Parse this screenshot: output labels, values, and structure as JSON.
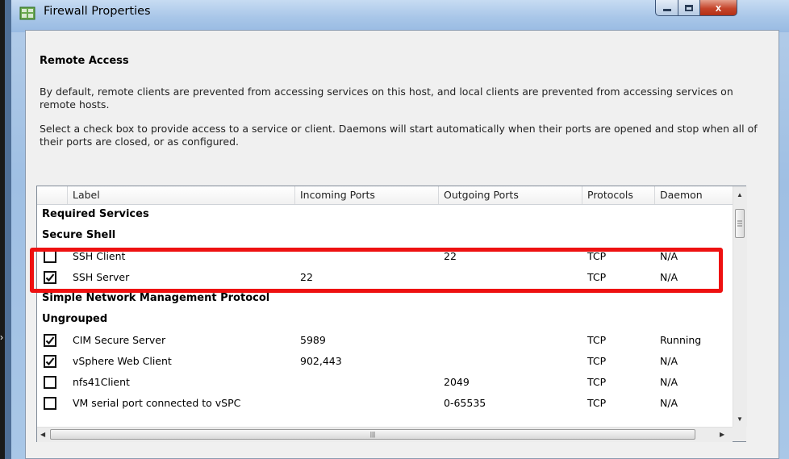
{
  "window": {
    "title": "Firewall Properties",
    "close_glyph": "x"
  },
  "section": {
    "title": "Remote Access",
    "paragraph1": "By default, remote clients are prevented from accessing services on this host, and local clients are prevented from accessing services on remote hosts.",
    "paragraph2": "Select a check box to provide access to a service or client. Daemons will start automatically when their ports are opened and stop when all of their ports are closed, or as configured."
  },
  "table": {
    "columns": [
      "Label",
      "Incoming Ports",
      "Outgoing Ports",
      "Protocols",
      "Daemon"
    ],
    "groups": {
      "required": "Required Services",
      "ssh": "Secure Shell",
      "snmp": "Simple Network Management Protocol",
      "ungrouped": "Ungrouped"
    },
    "rows": [
      {
        "label": "SSH Client",
        "incoming": "",
        "outgoing": "22",
        "protocol": "TCP",
        "daemon": "N/A",
        "checked": false
      },
      {
        "label": "SSH Server",
        "incoming": "22",
        "outgoing": "",
        "protocol": "TCP",
        "daemon": "N/A",
        "checked": true
      },
      {
        "label": "CIM Secure Server",
        "incoming": "5989",
        "outgoing": "",
        "protocol": "TCP",
        "daemon": "Running",
        "checked": true
      },
      {
        "label": "vSphere Web Client",
        "incoming": "902,443",
        "outgoing": "",
        "protocol": "TCP",
        "daemon": "N/A",
        "checked": true
      },
      {
        "label": "nfs41Client",
        "incoming": "",
        "outgoing": "2049",
        "protocol": "TCP",
        "daemon": "N/A",
        "checked": false
      },
      {
        "label": "VM serial port connected to vSPC",
        "incoming": "",
        "outgoing": "0-65535",
        "protocol": "TCP",
        "daemon": "N/A",
        "checked": false
      }
    ]
  },
  "colors": {
    "highlight": "#ee1111",
    "title_bar": "#a8c6e8",
    "close_button": "#c5452b"
  },
  "icons": [
    "firewall-app-icon",
    "minimize-icon",
    "maximize-icon",
    "close-icon",
    "checkbox-icon",
    "scroll-up-arrow-icon",
    "scroll-down-arrow-icon",
    "scroll-left-arrow-icon",
    "scroll-right-arrow-icon",
    "grip-icon"
  ]
}
